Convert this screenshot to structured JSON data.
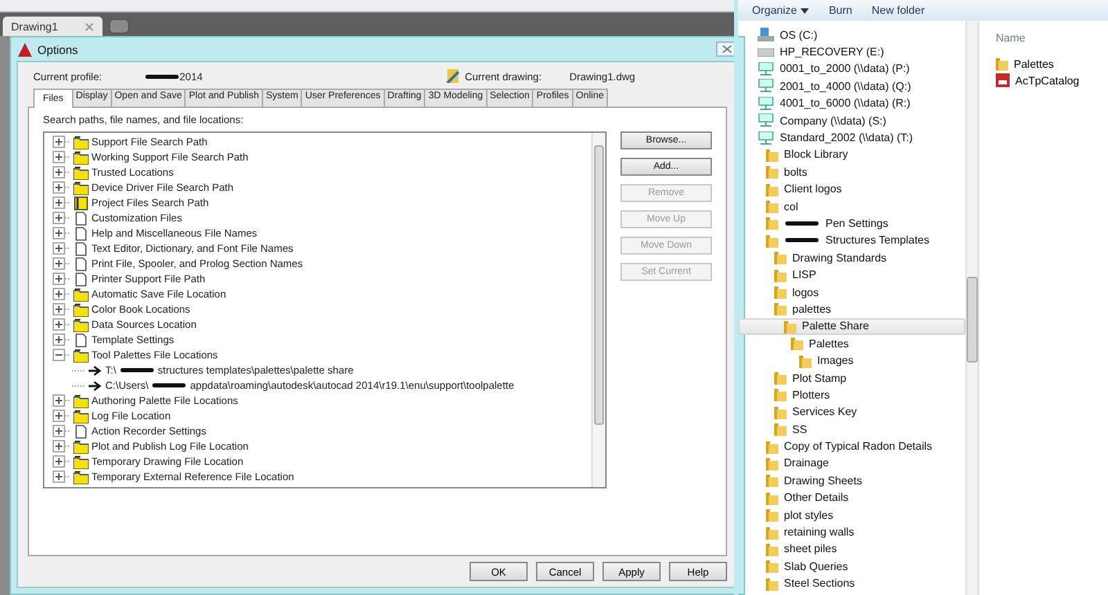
{
  "doc_tabs": [
    {
      "label": "Drawing1",
      "selected": true
    }
  ],
  "dialog": {
    "title": "Options",
    "profile_label": "Current profile:",
    "profile_value": {
      "text": "2014",
      "redacted": true
    },
    "drawing_label": "Current drawing:",
    "drawing_value": "Drawing1.dwg",
    "tabs": [
      {
        "label": "Files",
        "selected": true
      },
      {
        "label": "Display",
        "selected": false
      },
      {
        "label": "Open and Save",
        "selected": false
      },
      {
        "label": "Plot and Publish",
        "selected": false
      },
      {
        "label": "System",
        "selected": false
      },
      {
        "label": "User Preferences",
        "selected": false
      },
      {
        "label": "Drafting",
        "selected": false
      },
      {
        "label": "3D Modeling",
        "selected": false
      },
      {
        "label": "Selection",
        "selected": false
      },
      {
        "label": "Profiles",
        "selected": false
      },
      {
        "label": "Online",
        "selected": false
      }
    ],
    "list_label": "Search paths, file names, and file locations:",
    "tree": [
      {
        "label": "Support File Search Path",
        "kind": "folder",
        "expanded": false
      },
      {
        "label": "Working Support File Search Path",
        "kind": "folder",
        "expanded": false
      },
      {
        "label": "Trusted Locations",
        "kind": "folder",
        "expanded": false
      },
      {
        "label": "Device Driver File Search Path",
        "kind": "folder",
        "expanded": false
      },
      {
        "label": "Project Files Search Path",
        "kind": "project",
        "expanded": false
      },
      {
        "label": "Customization Files",
        "kind": "file",
        "expanded": false
      },
      {
        "label": "Help and Miscellaneous File Names",
        "kind": "file",
        "expanded": false
      },
      {
        "label": "Text Editor, Dictionary, and Font File Names",
        "kind": "file",
        "expanded": false
      },
      {
        "label": "Print File, Spooler, and Prolog Section Names",
        "kind": "file",
        "expanded": false
      },
      {
        "label": "Printer Support File Path",
        "kind": "file",
        "expanded": false
      },
      {
        "label": "Automatic Save File Location",
        "kind": "folder",
        "expanded": false
      },
      {
        "label": "Color Book Locations",
        "kind": "folder",
        "expanded": false
      },
      {
        "label": "Data Sources Location",
        "kind": "folder",
        "expanded": false
      },
      {
        "label": "Template Settings",
        "kind": "file",
        "expanded": false
      },
      {
        "label": "Tool Palettes File Locations",
        "kind": "folder",
        "expanded": true,
        "children": [
          {
            "prefix": "T:\\",
            "label": "structures templates\\palettes\\palette share",
            "redacted": true
          },
          {
            "prefix": "C:\\Users\\",
            "label": "appdata\\roaming\\autodesk\\autocad 2014\\r19.1\\enu\\support\\toolpalette",
            "redacted": true
          }
        ]
      },
      {
        "label": "Authoring Palette File Locations",
        "kind": "folder",
        "expanded": false
      },
      {
        "label": "Log File Location",
        "kind": "folder",
        "expanded": false
      },
      {
        "label": "Action Recorder Settings",
        "kind": "file",
        "expanded": false
      },
      {
        "label": "Plot and Publish Log File Location",
        "kind": "folder",
        "expanded": false
      },
      {
        "label": "Temporary Drawing File Location",
        "kind": "folder",
        "expanded": false
      },
      {
        "label": "Temporary External Reference File Location",
        "kind": "folder",
        "expanded": false
      }
    ],
    "side_buttons": [
      {
        "label": "Browse...",
        "disabled": false
      },
      {
        "label": "Add...",
        "disabled": false
      },
      {
        "label": "Remove",
        "disabled": true
      },
      {
        "label": "Move Up",
        "disabled": true
      },
      {
        "label": "Move Down",
        "disabled": true
      },
      {
        "label": "Set Current",
        "disabled": true
      }
    ],
    "footer_buttons": [
      "OK",
      "Cancel",
      "Apply",
      "Help"
    ]
  },
  "explorer": {
    "toolbar": [
      {
        "label": "Organize",
        "dropdown": true
      },
      {
        "label": "Burn",
        "dropdown": false
      },
      {
        "label": "New folder",
        "dropdown": false
      }
    ],
    "tree": [
      {
        "label": "OS (C:)",
        "kind": "os-drive"
      },
      {
        "label": "HP_RECOVERY (E:)",
        "kind": "drive"
      },
      {
        "label": "0001_to_2000 (\\\\data) (P:)",
        "kind": "network"
      },
      {
        "label": "2001_to_4000 (\\\\data) (Q:)",
        "kind": "network"
      },
      {
        "label": "4001_to_6000 (\\\\data) (R:)",
        "kind": "network"
      },
      {
        "label": "Company (\\\\data) (S:)",
        "kind": "network"
      },
      {
        "label": "Standard_2002 (\\\\data) (T:)",
        "kind": "network",
        "children": [
          {
            "label": "Block Library",
            "kind": "folder"
          },
          {
            "label": "bolts",
            "kind": "folder"
          },
          {
            "label": "Client logos",
            "kind": "folder"
          },
          {
            "label": "col",
            "kind": "folder"
          },
          {
            "label": "Pen Settings",
            "kind": "folder",
            "redacted": true
          },
          {
            "label": "Structures Templates",
            "kind": "folder",
            "redacted": true,
            "children": [
              {
                "label": "Drawing Standards",
                "kind": "folder"
              },
              {
                "label": "LISP",
                "kind": "folder"
              },
              {
                "label": "logos",
                "kind": "folder"
              },
              {
                "label": "palettes",
                "kind": "folder",
                "children": [
                  {
                    "label": "Palette Share",
                    "kind": "folder",
                    "selected": true,
                    "children": [
                      {
                        "label": "Palettes",
                        "kind": "folder",
                        "children": [
                          {
                            "label": "Images",
                            "kind": "folder"
                          }
                        ]
                      }
                    ]
                  }
                ]
              },
              {
                "label": "Plot Stamp",
                "kind": "folder"
              },
              {
                "label": "Plotters",
                "kind": "folder"
              },
              {
                "label": "Services Key",
                "kind": "folder"
              },
              {
                "label": "SS",
                "kind": "folder"
              }
            ]
          },
          {
            "label": "Copy of Typical Radon Details",
            "kind": "folder"
          },
          {
            "label": "Drainage",
            "kind": "folder"
          },
          {
            "label": "Drawing Sheets",
            "kind": "folder"
          },
          {
            "label": "Other Details",
            "kind": "folder"
          },
          {
            "label": "plot styles",
            "kind": "folder"
          },
          {
            "label": "retaining walls",
            "kind": "folder"
          },
          {
            "label": "sheet piles",
            "kind": "folder"
          },
          {
            "label": "Slab Queries",
            "kind": "folder"
          },
          {
            "label": "Steel Sections",
            "kind": "folder"
          }
        ]
      }
    ],
    "column_header": "Name",
    "files": [
      {
        "label": "Palettes",
        "kind": "folder"
      },
      {
        "label": "AcTpCatalog",
        "kind": "catalog"
      }
    ]
  }
}
